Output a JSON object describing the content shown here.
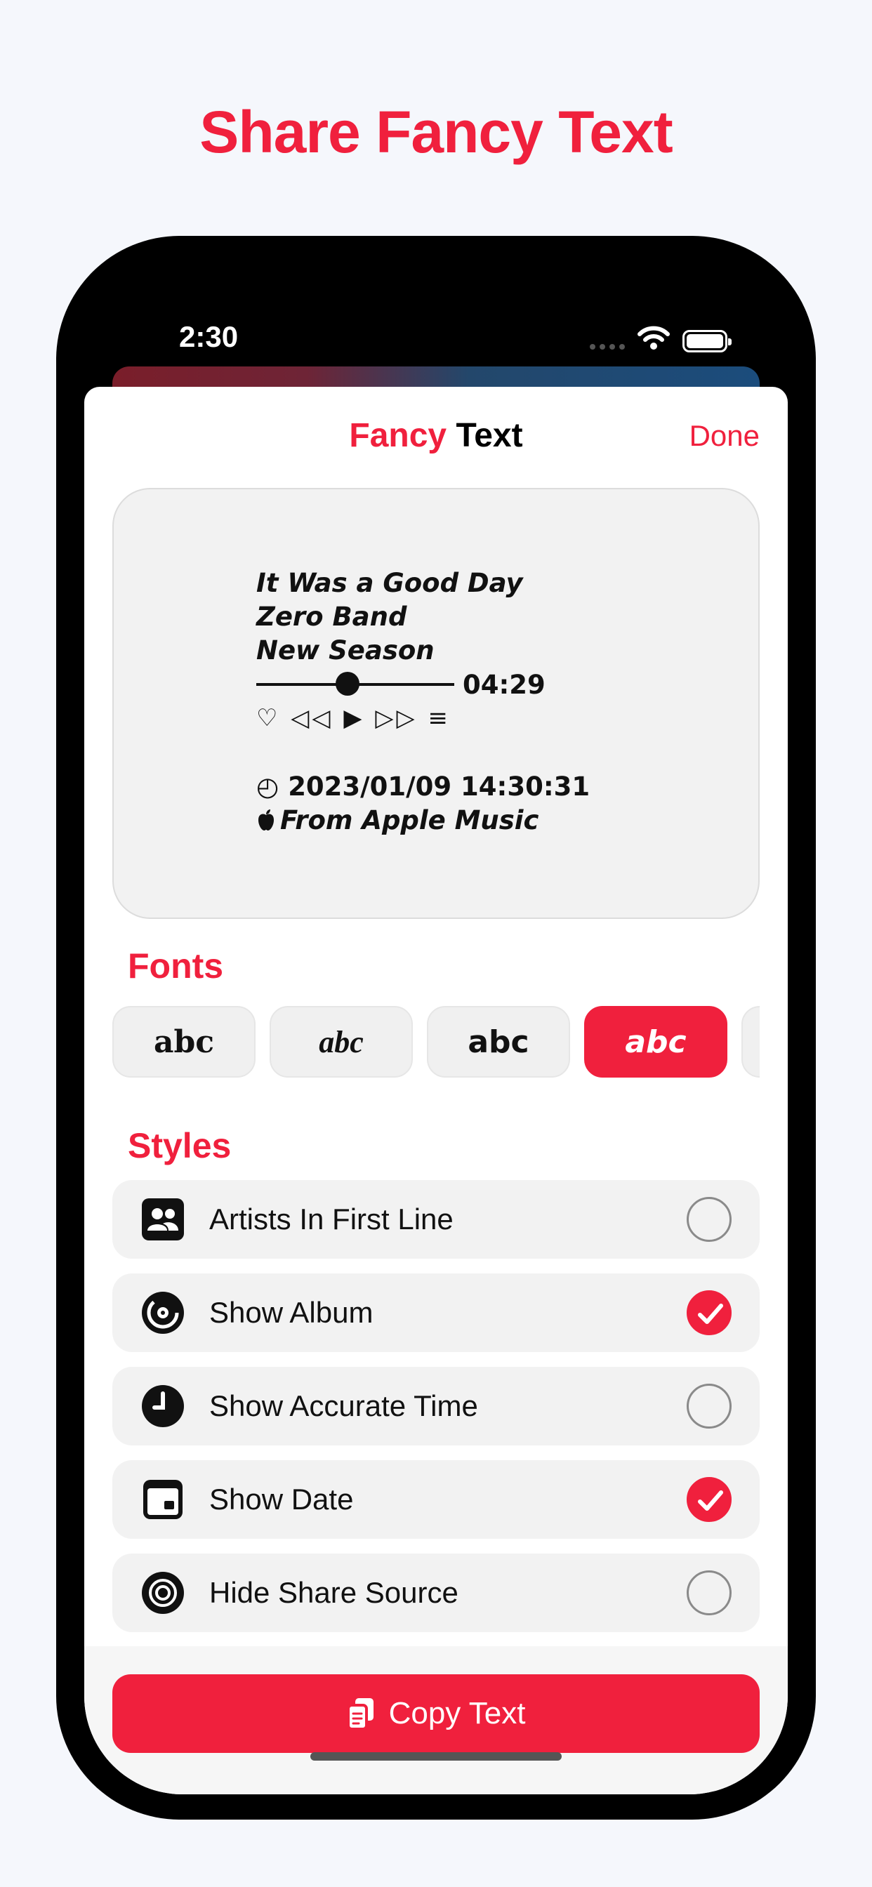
{
  "headline": "Share Fancy Text",
  "status_bar": {
    "time": "2:30"
  },
  "nav": {
    "title_accent": "Fancy",
    "title_rest": "Text",
    "done_label": "Done"
  },
  "preview": {
    "song": "It Was a Good Day",
    "artist": "Zero Band",
    "album": "New Season",
    "duration": "04:29",
    "progress": 0.46,
    "controls": "♡ ◁◁ ▶ ▷▷ ≡",
    "date_icon": "◴",
    "datetime": "2023/01/09 14:30:31",
    "source": "From Apple Music"
  },
  "fonts": {
    "title": "Fonts",
    "chips": [
      {
        "label": "abc",
        "selected": false
      },
      {
        "label": "abc",
        "selected": false
      },
      {
        "label": "abc",
        "selected": false
      },
      {
        "label": "abc",
        "selected": true
      }
    ]
  },
  "styles": {
    "title": "Styles",
    "items": [
      {
        "label": "Artists In First Line",
        "icon": "people-icon",
        "checked": false
      },
      {
        "label": "Show Album",
        "icon": "album-icon",
        "checked": true
      },
      {
        "label": "Show Accurate Time",
        "icon": "clock-icon",
        "checked": false
      },
      {
        "label": "Show Date",
        "icon": "calendar-icon",
        "checked": true
      },
      {
        "label": "Hide Share Source",
        "icon": "music-source-icon",
        "checked": false
      }
    ]
  },
  "copy_button": {
    "label": "Copy Text",
    "icon": "copy-icon"
  },
  "colors": {
    "accent": "#F0203D",
    "background": "#F5F7FC"
  }
}
